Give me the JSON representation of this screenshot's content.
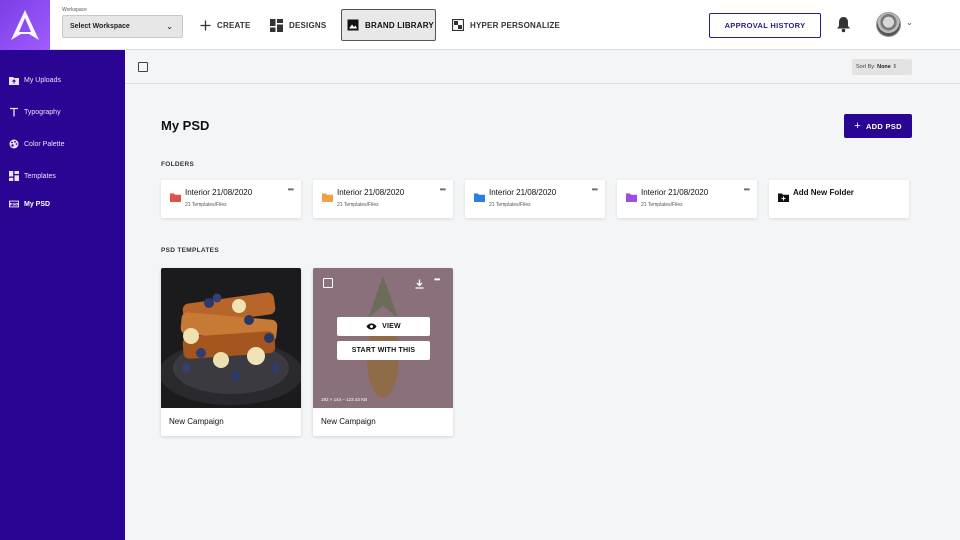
{
  "workspace": {
    "label": "Workspace",
    "selected": "Select Workspace"
  },
  "nav": {
    "create": "CREATE",
    "designs": "DESIGNS",
    "brand_library": "BRAND LIBRARY",
    "hyper_personalize": "HYPER PERSONALIZE"
  },
  "header": {
    "approval_history": "APPROVAL HISTORY"
  },
  "sidebar": {
    "items": [
      {
        "label": "My Uploads",
        "icon": "upload-folder-icon"
      },
      {
        "label": "Typography",
        "icon": "typography-icon"
      },
      {
        "label": "Color Palette",
        "icon": "palette-icon"
      },
      {
        "label": "Templates",
        "icon": "templates-icon"
      },
      {
        "label": "My PSD",
        "icon": "psd-icon",
        "active": true
      }
    ]
  },
  "toolbar": {
    "sort_label": "Sort By:",
    "sort_value": "None"
  },
  "main": {
    "title": "My PSD",
    "add_button": "ADD PSD",
    "folders_label": "FOLDERS",
    "templates_label": "PSD TEMPLATES"
  },
  "folders": [
    {
      "name": "Interior 21/08/2020",
      "count": "21 Templates/Files",
      "color": "#e0504f"
    },
    {
      "name": "Interior 21/08/2020",
      "count": "21 Templates/Files",
      "color": "#f0a04a"
    },
    {
      "name": "Interior 21/08/2020",
      "count": "21 Templates/Files",
      "color": "#2f7de1"
    },
    {
      "name": "Interior 21/08/2020",
      "count": "21 Templates/Files",
      "color": "#9b4ee0"
    }
  ],
  "add_folder": "Add New Folder",
  "templates": [
    {
      "name": "New Campaign"
    },
    {
      "name": "New Campaign",
      "view": "VIEW",
      "start": "START WITH THIS",
      "meta": "192 × 144 – 123.43 KB"
    }
  ],
  "colors": {
    "brand": "#2a0493",
    "accent": "#2d1b87"
  }
}
